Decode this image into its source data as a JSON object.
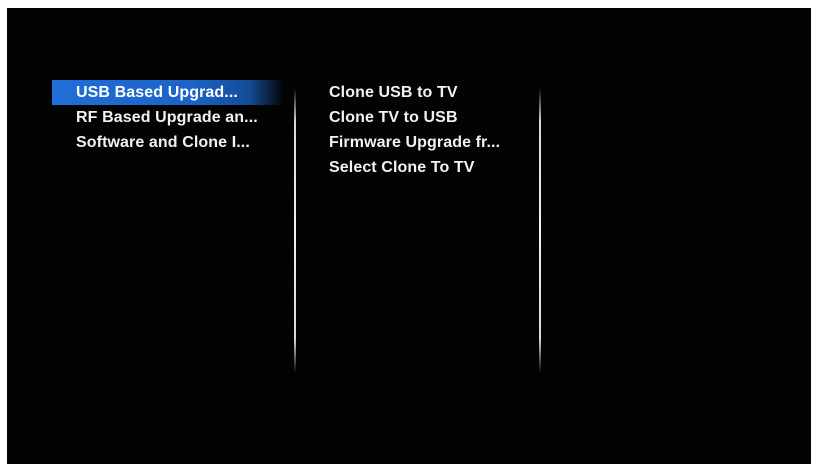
{
  "menu": {
    "left": [
      {
        "label": "USB Based Upgrad...",
        "selected": true
      },
      {
        "label": "RF Based Upgrade an...",
        "selected": false
      },
      {
        "label": "Software and Clone I...",
        "selected": false
      }
    ],
    "middle": [
      {
        "label": "Clone USB to TV"
      },
      {
        "label": "Clone TV to USB"
      },
      {
        "label": "Firmware Upgrade fr..."
      },
      {
        "label": "Select Clone To TV"
      }
    ]
  },
  "colors": {
    "background": "#030303",
    "highlight": "#1f6fd6",
    "text": "#f2f2f2"
  }
}
